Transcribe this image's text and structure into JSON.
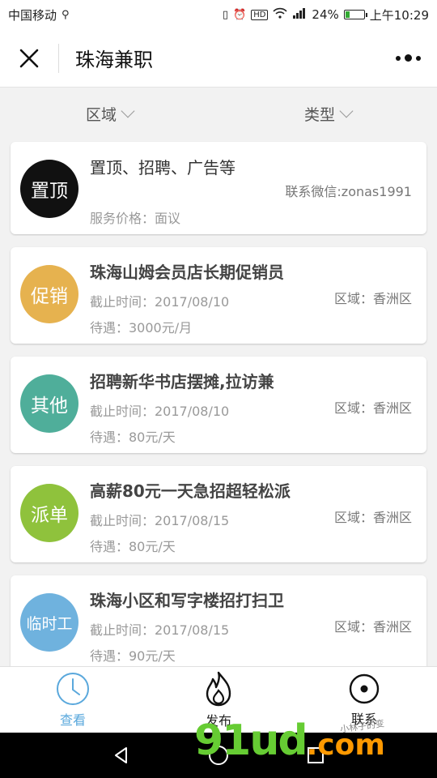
{
  "status_bar": {
    "carrier": "中国移动",
    "battery_text": "24%",
    "time": "上午10:29",
    "battery_level": 0.24
  },
  "navbar": {
    "title": "珠海兼职"
  },
  "filters": {
    "area": "区域",
    "type": "类型"
  },
  "pinned": {
    "badge": "置顶",
    "title": "置顶、招聘、广告等",
    "contact": "联系微信:zonas1991",
    "price": "服务价格：面议",
    "badge_color": "#111111"
  },
  "jobs": [
    {
      "badge": "促销",
      "badge_color": "#e6b24f",
      "title": "珠海山姆会员店长期促销员",
      "deadline": "截止时间：2017/08/10",
      "pay": "待遇：3000元/月",
      "area": "区域：香洲区"
    },
    {
      "badge": "其他",
      "badge_color": "#4fae9a",
      "title": "招聘新华书店摆摊,拉访兼",
      "deadline": "截止时间：2017/08/10",
      "pay": "待遇：80元/天",
      "area": "区域：香洲区"
    },
    {
      "badge": "派单",
      "badge_color": "#8fc23c",
      "title": "高薪80元一天急招超轻松派",
      "deadline": "截止时间：2017/08/15",
      "pay": "待遇：80元/天",
      "area": "区域：香洲区"
    },
    {
      "badge": "临时工",
      "badge_color": "#6fb2de",
      "title": "珠海小区和写字楼招打扫卫",
      "deadline": "截止时间：2017/08/15",
      "pay": "待遇：90元/天",
      "area": "区域：香洲区"
    }
  ],
  "tabs": [
    {
      "label": "查看",
      "icon": "clock-icon",
      "active": true
    },
    {
      "label": "发布",
      "icon": "flame-icon",
      "active": false
    },
    {
      "label": "联系",
      "icon": "target-icon",
      "active": false
    }
  ],
  "watermark": {
    "text": "91ud",
    "suffix": ".com",
    "caption": "小林子的变"
  }
}
